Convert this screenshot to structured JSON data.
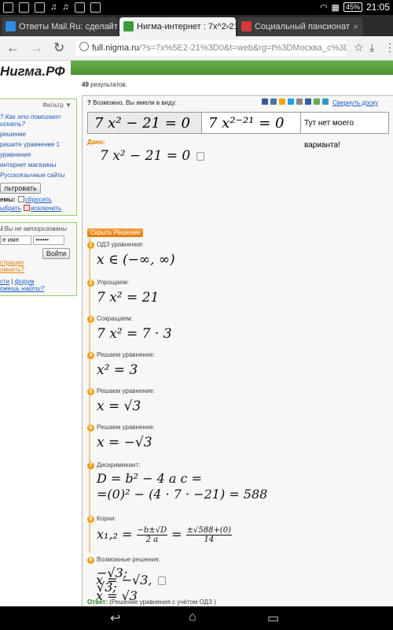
{
  "status": {
    "time": "21:05",
    "battery": "45%"
  },
  "tabs": [
    {
      "title": "Ответы Mail.Ru: сделайте у",
      "fav_color": "#2f8de4"
    },
    {
      "title": "Нигма-интернет : 7x^2-21=",
      "fav_color": "#3a9a3a"
    },
    {
      "title": "Социальный пансионат",
      "fav_color": "#d23a3a"
    }
  ],
  "url": {
    "host": "full.nigma.ru",
    "path": "/?s=7x%5E2-21%3D0&t=web&rg=t%3DМосква_с%3DРо"
  },
  "logo": "Нигма.РФ",
  "results": {
    "count": "49",
    "label": "результатов."
  },
  "left": {
    "filter": "Фильтр",
    "how_help": "Как это помогает искать?",
    "links": [
      "решение",
      "решите уравнение 1",
      "уравнения",
      "интернет магазины",
      "Русскоязычные сайты"
    ],
    "filter_btn": "льтровать",
    "themes_label": "емы:",
    "reset": "сбросить",
    "select": "ыбрать",
    "exclude": "исключить",
    "not_auth": "Вы не авторизованы",
    "login_placeholder": "е имя",
    "password_value": "••••••",
    "login_btn": "Войти",
    "reg": "страция",
    "remember": "омнить?",
    "news": "сти",
    "forum": "форум",
    "not_found": "ожешь найти?"
  },
  "main": {
    "maybe": "Возможно, Вы имели в виду:",
    "collapse": "Свернуть доску",
    "options": [
      "7 x² − 21 = 0",
      "7 x²⁻²¹ = 0",
      "Тут нет моего варианта!"
    ],
    "given_label": "Дано:",
    "given": "7 x² − 21 = 0",
    "hide_btn": "Скрыть Решение",
    "steps": [
      {
        "n": "1",
        "label": "ОДЗ уравнения:",
        "math": "x ∈ (−∞, ∞)"
      },
      {
        "n": "2",
        "label": "Упрощаем:",
        "math": "7 x² = 21"
      },
      {
        "n": "3",
        "label": "Сокращаем:",
        "math": "7 x² = 7 · 3"
      },
      {
        "n": "4",
        "label": "Решаем уравнение:",
        "math": "x² = 3"
      },
      {
        "n": "5",
        "label": "Решаем уравнение:",
        "math": "x = √3"
      },
      {
        "n": "6",
        "label": "Решаем уравнение:",
        "math": "x = −√3"
      },
      {
        "n": "7",
        "label": "Дискриминант:",
        "math": "D = b² − 4 a c =",
        "math2": "=(0)² − (4 · 7 · −21) = 588"
      },
      {
        "n": "8",
        "label": "Корни:",
        "math_lhs": "x₁,₂ =",
        "f1n": "−b±√D",
        "f1d": "2 a",
        "f2n": "±√588+(0)",
        "f2d": "14"
      },
      {
        "n": "9",
        "label": "Возможные решения:",
        "math": "−√3;",
        "math2": "√3;"
      }
    ],
    "answer_label": "Ответ:",
    "answer_note": "(Решение уравнения с учётом ОДЗ )",
    "answer1": "x = −√3,",
    "answer2": "x = √3"
  }
}
